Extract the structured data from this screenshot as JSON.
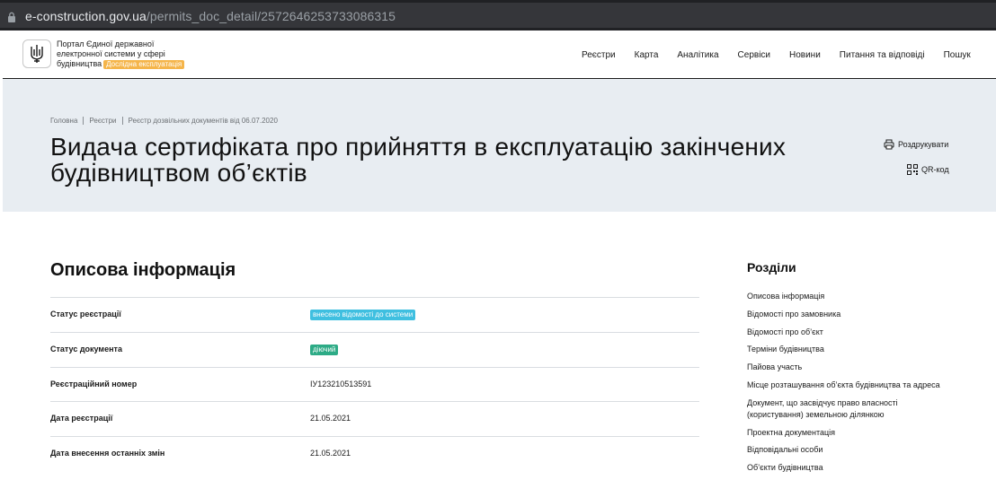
{
  "browser": {
    "url_host": "e-construction.gov.ua",
    "url_path": "/permits_doc_detail/2572646253733086315"
  },
  "header": {
    "portal_line1": "Портал Єдиної державної",
    "portal_line2": "електронної системи у сфері",
    "portal_line3": "будівництва",
    "beta_badge": "Дослідна експлуатація",
    "nav": [
      "Реєстри",
      "Карта",
      "Аналітика",
      "Сервіси",
      "Новини",
      "Питання та відповіді",
      "Пошук"
    ]
  },
  "hero": {
    "breadcrumb": [
      "Головна",
      "Реєстри",
      "Реєстр дозвільних документів від 06.07.2020"
    ],
    "title": "Видача сертифіката про прийняття в експлуатацію закінчених будівництвом об’єктів",
    "print_label": "Роздрукувати",
    "qr_label": "QR-код"
  },
  "info": {
    "title": "Описова інформація",
    "rows": [
      {
        "label": "Статус реєстрації",
        "value": "внесено відомості до системи"
      },
      {
        "label": "Статус документа",
        "value": "діючий"
      },
      {
        "label": "Реєстраційний номер",
        "value": "ІУ123210513591"
      },
      {
        "label": "Дата реєстрації",
        "value": "21.05.2021"
      },
      {
        "label": "Дата внесення останніх змін",
        "value": "21.05.2021"
      }
    ]
  },
  "sections": {
    "title": "Розділи",
    "items": [
      "Описова інформація",
      "Відомості про замовника",
      "Відомості про об’єкт",
      "Терміни будівництва",
      "Пайова участь",
      "Місце розташування об’єкта будівництва та адреса",
      "Документ, що засвідчує право власності (користування) земельною ділянкою",
      "Проектна документація",
      "Відповідальні особи",
      "Об’єкти будівництва"
    ]
  },
  "colors": {
    "badge_blue": "#3fbfe0",
    "badge_green": "#2dab86",
    "beta": "#f5b54a",
    "hero_bg": "#e8edf2"
  }
}
